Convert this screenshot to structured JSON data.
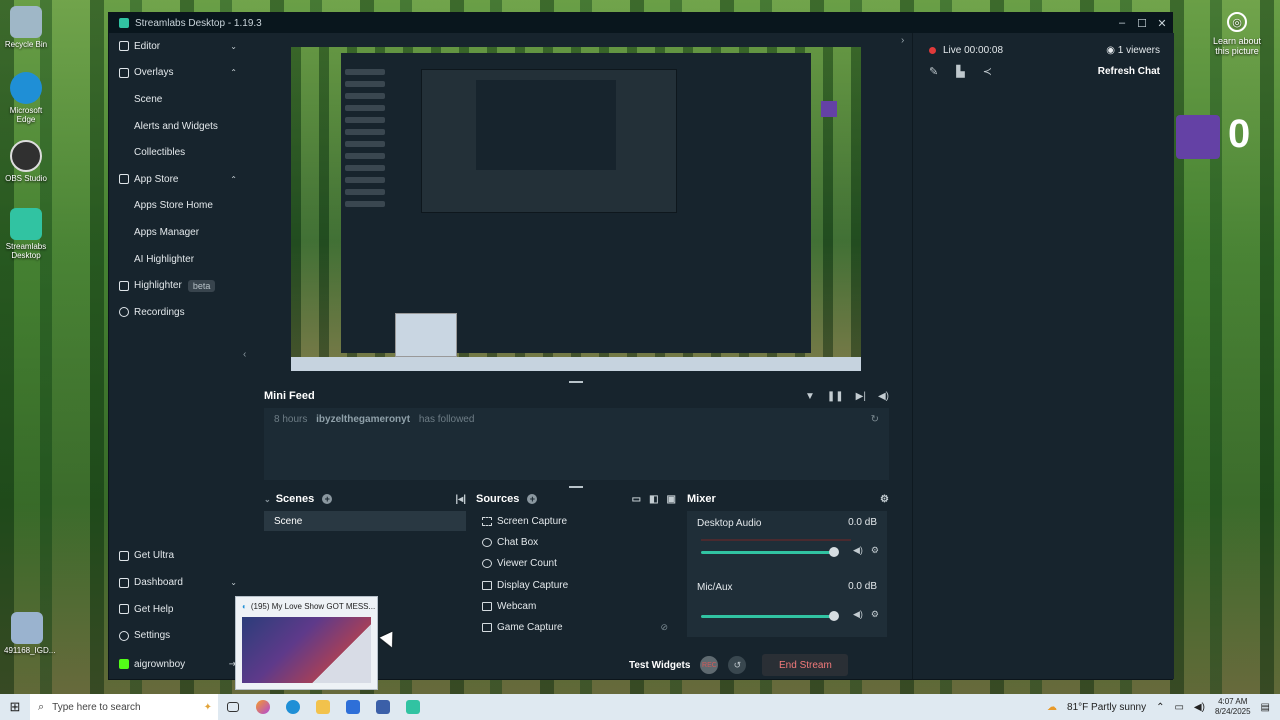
{
  "desktop": {
    "icons": [
      {
        "label": "Recycle Bin",
        "color": "#9fb7c7"
      },
      {
        "label": "Microsoft Edge",
        "color": "#1f8fd6"
      },
      {
        "label": "OBS Studio",
        "color": "#303030"
      },
      {
        "label": "Streamlabs Desktop",
        "color": "#31c3a2"
      },
      {
        "label": "491168_IGD...",
        "color": "#9ab3cf"
      }
    ],
    "learn_label": "Learn about this picture",
    "twitch_count": "0"
  },
  "window": {
    "title": "Streamlabs Desktop - 1.19.3",
    "controls": [
      "–",
      "☐",
      "✕"
    ]
  },
  "sidebar": {
    "items": [
      {
        "label": "Editor",
        "chevron": "⌄"
      },
      {
        "label": "Overlays",
        "chevron": "⌃"
      },
      {
        "label": "Scene"
      },
      {
        "label": "Alerts and Widgets"
      },
      {
        "label": "Collectibles"
      },
      {
        "label": "App Store",
        "chevron": "⌃"
      },
      {
        "label": "Apps Store Home"
      },
      {
        "label": "Apps Manager"
      },
      {
        "label": "AI Highlighter"
      },
      {
        "label": "Highlighter",
        "badge": "beta"
      },
      {
        "label": "Recordings"
      }
    ],
    "bottom": [
      {
        "label": "Get Ultra"
      },
      {
        "label": "Dashboard",
        "chevron": "⌄"
      },
      {
        "label": "Get Help"
      },
      {
        "label": "Settings"
      },
      {
        "label": "aigrownboy"
      }
    ]
  },
  "minifeed": {
    "title": "Mini Feed",
    "time": "8 hours",
    "user": "ibyzelthegameronyt",
    "action": "has followed"
  },
  "scenes": {
    "title": "Scenes",
    "items": [
      "Scene"
    ]
  },
  "sources": {
    "title": "Sources",
    "items": [
      "Screen Capture",
      "Chat Box",
      "Viewer Count",
      "Display Capture",
      "Webcam",
      "Game Capture"
    ]
  },
  "mixer": {
    "title": "Mixer",
    "channels": [
      {
        "name": "Desktop Audio",
        "db": "0.0 dB",
        "level": 1.0
      },
      {
        "name": "Mic/Aux",
        "db": "0.0 dB",
        "level": 1.0
      }
    ]
  },
  "footer": {
    "test_widgets": "Test Widgets",
    "end_stream": "End Stream"
  },
  "chat": {
    "live": "Live 00:00:08",
    "viewers": "1 viewers",
    "refresh": "Refresh Chat"
  },
  "taskbar": {
    "search_placeholder": "Type here to search",
    "weather": "81°F  Partly sunny",
    "time": "4:07 AM",
    "date": "8/24/2025"
  },
  "thumbnail": {
    "title": "(195) My Love Show GOT MESS..."
  },
  "colors": {
    "accent": "#31c3a2",
    "live_dot": "#e03a3a",
    "end_stream_text": "#f27a7a"
  }
}
